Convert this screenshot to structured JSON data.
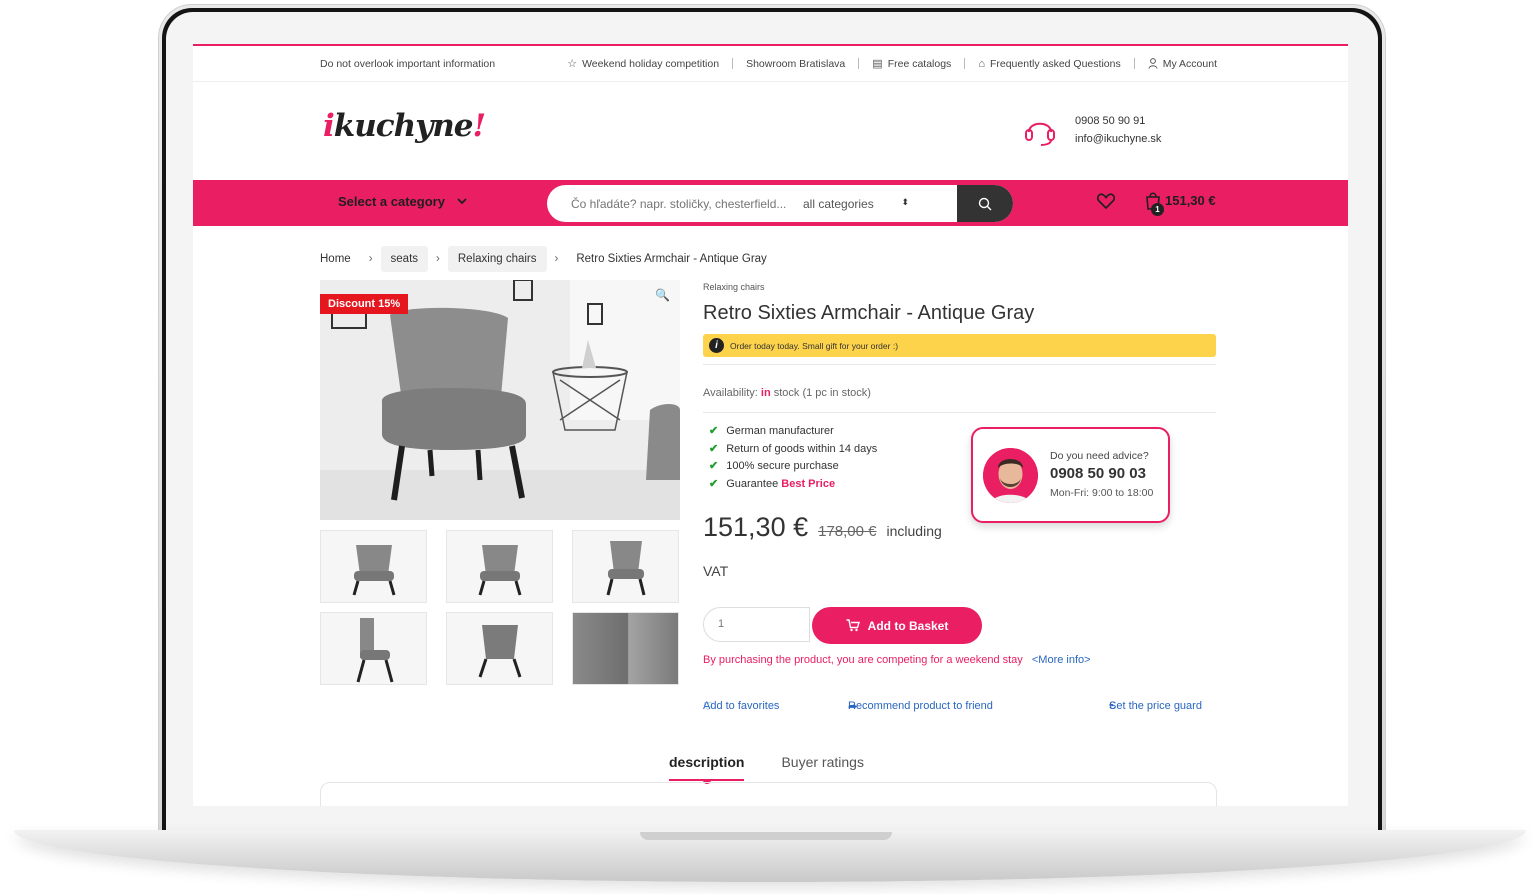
{
  "topbar": {
    "notice": "Do not overlook important information",
    "links": [
      {
        "label": "Weekend holiday competition",
        "icon": "star-icon"
      },
      {
        "label": "Showroom Bratislava",
        "icon": ""
      },
      {
        "label": "Free catalogs",
        "icon": "catalog-icon"
      },
      {
        "label": "Frequently asked Questions",
        "icon": "lock-icon"
      },
      {
        "label": "My Account",
        "icon": "user-icon"
      }
    ]
  },
  "header": {
    "logo_prefix": "i",
    "logo_main": "kuchyne",
    "logo_suffix": "!",
    "phone": "0908 50 90 91",
    "email": "info@ikuchyne.sk"
  },
  "nav": {
    "category_label": "Select a category",
    "search_placeholder": "Čo hľadáte? napr. stoličky, chesterfield...",
    "search_scope": "all categories",
    "cart_count": "1",
    "cart_total": "151,30 €",
    "accent": "#e91e63"
  },
  "breadcrumb": [
    "Home",
    "seats",
    "Relaxing chairs",
    "Retro Sixties Armchair - Antique Gray"
  ],
  "gallery": {
    "discount_label": "Discount 15%"
  },
  "product": {
    "category": "Relaxing chairs",
    "title": "Retro Sixties Armchair - Antique Gray",
    "promo": "Order today today. Small gift for your order :)",
    "availability_label": "Availability:",
    "availability_in": "in",
    "availability_rest": "stock (1 pc in stock)",
    "features": [
      "German manufacturer",
      "Return of goods within 14 days",
      "100% secure purchase",
      "Guarantee"
    ],
    "best_price": "Best Price",
    "price": "151,30 €",
    "old_price": "178,00 €",
    "including": "including",
    "vat": "VAT",
    "quantity": "1",
    "add_to_basket": "Add to Basket",
    "compete_text": "By purchasing the product, you are competing for a weekend stay",
    "more_info": "<More info>",
    "add_favorites": "Add to favorites",
    "recommend": "Recommend product to friend",
    "price_guard": "Set the price guard"
  },
  "advice": {
    "question": "Do you need advice?",
    "phone": "0908 50 90 03",
    "hours": "Mon-Fri: 9:00 to 18:00"
  },
  "tabs": [
    {
      "label": "description",
      "active": true
    },
    {
      "label": "Buyer ratings",
      "active": false
    }
  ]
}
